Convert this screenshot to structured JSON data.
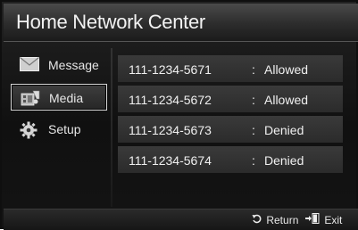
{
  "title": "Home Network Center",
  "sidebar": {
    "items": [
      {
        "label": "Message",
        "icon": "envelope-icon",
        "selected": false
      },
      {
        "label": "Media",
        "icon": "film-icon",
        "selected": true
      },
      {
        "label": "Setup",
        "icon": "gear-icon",
        "selected": false
      }
    ]
  },
  "devices": [
    {
      "number": "111-1234-5671",
      "separator": ":",
      "status": "Allowed"
    },
    {
      "number": "111-1234-5672",
      "separator": ":",
      "status": "Allowed"
    },
    {
      "number": "111-1234-5673",
      "separator": ":",
      "status": "Denied"
    },
    {
      "number": "111-1234-5674",
      "separator": ":",
      "status": "Denied"
    }
  ],
  "footer": {
    "return_label": "Return",
    "return_icon": "return-arrow-icon",
    "exit_label": "Exit",
    "exit_icon": "exit-door-icon"
  }
}
